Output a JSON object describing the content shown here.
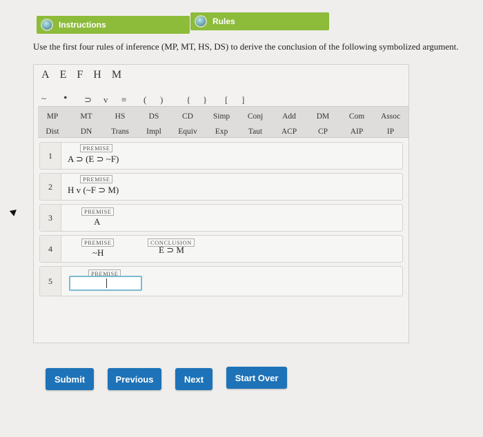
{
  "tabs": {
    "instructions": "Instructions",
    "rules": "Rules"
  },
  "question": "Use the first four rules of inference (MP, MT, HS, DS) to derive the conclusion of the following symbolized argument.",
  "letters": [
    "A",
    "E",
    "F",
    "H",
    "M"
  ],
  "symbols": [
    "~",
    "•",
    "⊃",
    "v",
    "≡",
    "(",
    ")",
    "{",
    "}",
    "[",
    "]"
  ],
  "rules_row1": [
    "MP",
    "MT",
    "HS",
    "DS",
    "CD",
    "Simp",
    "Conj",
    "Add",
    "DM",
    "Com",
    "Assoc"
  ],
  "rules_row2": [
    "Dist",
    "DN",
    "Trans",
    "Impl",
    "Equiv",
    "Exp",
    "Taut",
    "ACP",
    "CP",
    "AIP",
    "IP"
  ],
  "premise_tag": "PREMISE",
  "conclusion_tag": "CONCLUSION",
  "lines": [
    {
      "num": "1",
      "formula": "A ⊃ (E ⊃ ~F)"
    },
    {
      "num": "2",
      "formula": "H v (~F ⊃ M)"
    },
    {
      "num": "3",
      "formula": "A"
    },
    {
      "num": "4",
      "formula": "~H",
      "conclusion": "E ⊃ M"
    },
    {
      "num": "5",
      "value": ""
    }
  ],
  "buttons": {
    "submit": "Submit",
    "previous": "Previous",
    "next": "Next",
    "start_over": "Start Over"
  },
  "colors": {
    "tab_green": "#8dbb3a",
    "button_blue": "#1e73b8",
    "input_border": "#7bbad0"
  }
}
